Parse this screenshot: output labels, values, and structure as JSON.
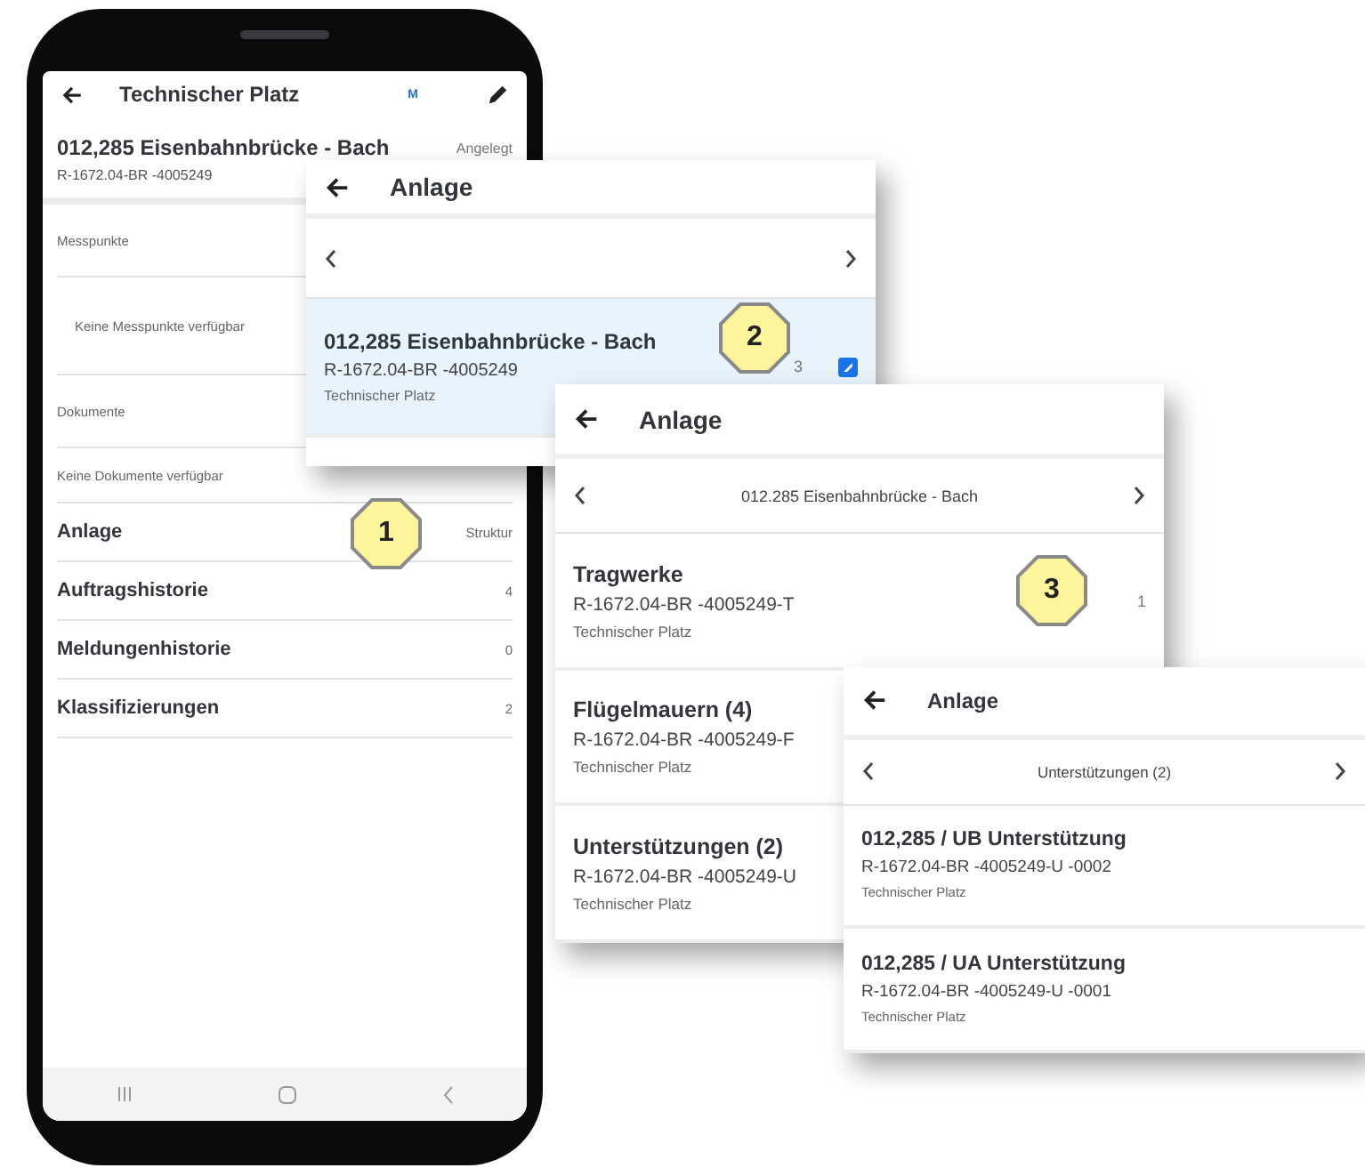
{
  "phone": {
    "title": "Technischer Platz",
    "user_badge": "M",
    "object_title": "012,285 Eisenbahnbrücke - Bach",
    "status": "Angelegt",
    "object_code": "R-1672.04-BR -4005249",
    "sections": [
      {
        "kind": "header",
        "label": "Messpunkte"
      },
      {
        "kind": "empty",
        "label": "Keine Messpunkte verfügbar"
      },
      {
        "kind": "header",
        "label": "Dokumente"
      },
      {
        "kind": "note",
        "label": "Keine Dokumente verfügbar"
      },
      {
        "kind": "link",
        "label": "Anlage",
        "value": "Struktur"
      },
      {
        "kind": "link",
        "label": "Auftragshistorie",
        "value": "4"
      },
      {
        "kind": "link",
        "label": "Meldungenhistorie",
        "value": "0"
      },
      {
        "kind": "link",
        "label": "Klassifizierungen",
        "value": "2"
      }
    ]
  },
  "panels": [
    {
      "title": "Anlage",
      "items": [
        {
          "title": "012,285 Eisenbahnbrücke - Bach",
          "code": "R-1672.04-BR -4005249",
          "type": "Technischer Platz",
          "count": "3",
          "selected": true
        }
      ]
    },
    {
      "title": "Anlage",
      "nav_title": "012.285 Eisenbahnbrücke - Bach",
      "items": [
        {
          "title": "Tragwerke",
          "code": "R-1672.04-BR -4005249-T",
          "type": "Technischer Platz",
          "count": "1",
          "selected": false
        },
        {
          "title": "Flügelmauern (4)",
          "code": "R-1672.04-BR -4005249-F",
          "type": "Technischer Platz",
          "selected": false
        },
        {
          "title": "Unterstützungen (2)",
          "code": "R-1672.04-BR -4005249-U",
          "type": "Technischer Platz",
          "selected": false
        }
      ]
    },
    {
      "title": "Anlage",
      "nav_title": "Unterstützungen (2)",
      "items": [
        {
          "title": "012,285 / UB Unterstützung",
          "code": "R-1672.04-BR -4005249-U -0002",
          "type": "Technischer Platz",
          "selected": false
        },
        {
          "title": "012,285 / UA Unterstützung",
          "code": "R-1672.04-BR -4005249-U -0001",
          "type": "Technischer Platz",
          "selected": false
        }
      ]
    }
  ],
  "badges": [
    "1",
    "2",
    "3"
  ]
}
